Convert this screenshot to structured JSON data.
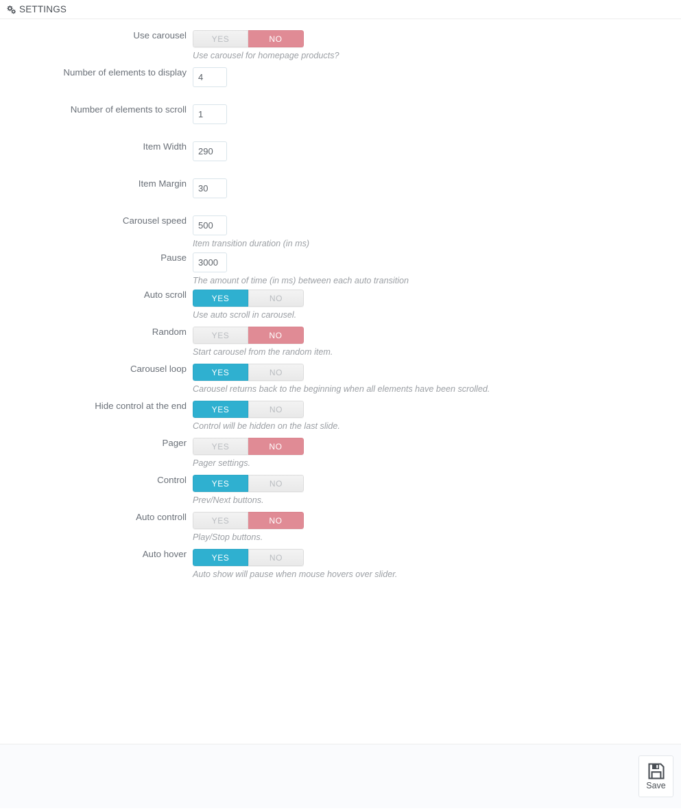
{
  "header": {
    "title": "SETTINGS",
    "icon": "cogs-icon"
  },
  "colors": {
    "toggle_yes_active": "#2fb0d0",
    "toggle_no_active": "#e08b95",
    "toggle_inactive_bg": "#eeeeee",
    "toggle_inactive_text": "#b9bcc0",
    "label_text": "#6a7078",
    "help_text": "#9b9fa4",
    "input_border": "#d9e4ea",
    "footer_bg": "#fafbfd"
  },
  "toggle": {
    "yes_label": "YES",
    "no_label": "NO"
  },
  "fields": [
    {
      "type": "toggle",
      "name": "use-carousel",
      "label": "Use carousel",
      "value": "NO",
      "help": "Use carousel for homepage products?"
    },
    {
      "type": "input",
      "name": "number-of-elements-to-display",
      "label": "Number of elements to display",
      "value": "4",
      "help": ""
    },
    {
      "type": "input",
      "name": "number-of-elements-to-scroll",
      "label": "Number of elements to scroll",
      "value": "1",
      "help": ""
    },
    {
      "type": "input",
      "name": "item-width",
      "label": "Item Width",
      "value": "290",
      "help": ""
    },
    {
      "type": "input",
      "name": "item-margin",
      "label": "Item Margin",
      "value": "30",
      "help": ""
    },
    {
      "type": "input",
      "name": "carousel-speed",
      "label": "Carousel speed",
      "value": "500",
      "help": "Item transition duration (in ms)"
    },
    {
      "type": "input",
      "name": "pause",
      "label": "Pause",
      "value": "3000",
      "help": "The amount of time (in ms) between each auto transition"
    },
    {
      "type": "toggle",
      "name": "auto-scroll",
      "label": "Auto scroll",
      "value": "YES",
      "help": "Use auto scroll in carousel."
    },
    {
      "type": "toggle",
      "name": "random",
      "label": "Random",
      "value": "NO",
      "help": "Start carousel from the random item."
    },
    {
      "type": "toggle",
      "name": "carousel-loop",
      "label": "Carousel loop",
      "value": "YES",
      "help": "Carousel returns back to the beginning when all elements have been scrolled."
    },
    {
      "type": "toggle",
      "name": "hide-control-at-the-end",
      "label": "Hide control at the end",
      "value": "YES",
      "help": "Control will be hidden on the last slide."
    },
    {
      "type": "toggle",
      "name": "pager",
      "label": "Pager",
      "value": "NO",
      "help": "Pager settings."
    },
    {
      "type": "toggle",
      "name": "control",
      "label": "Control",
      "value": "YES",
      "help": "Prev/Next buttons."
    },
    {
      "type": "toggle",
      "name": "auto-controll",
      "label": "Auto controll",
      "value": "NO",
      "help": "Play/Stop buttons."
    },
    {
      "type": "toggle",
      "name": "auto-hover",
      "label": "Auto hover",
      "value": "YES",
      "help": "Auto show will pause when mouse hovers over slider."
    }
  ],
  "footer": {
    "save_label": "Save",
    "save_icon": "floppy-disk-icon"
  }
}
